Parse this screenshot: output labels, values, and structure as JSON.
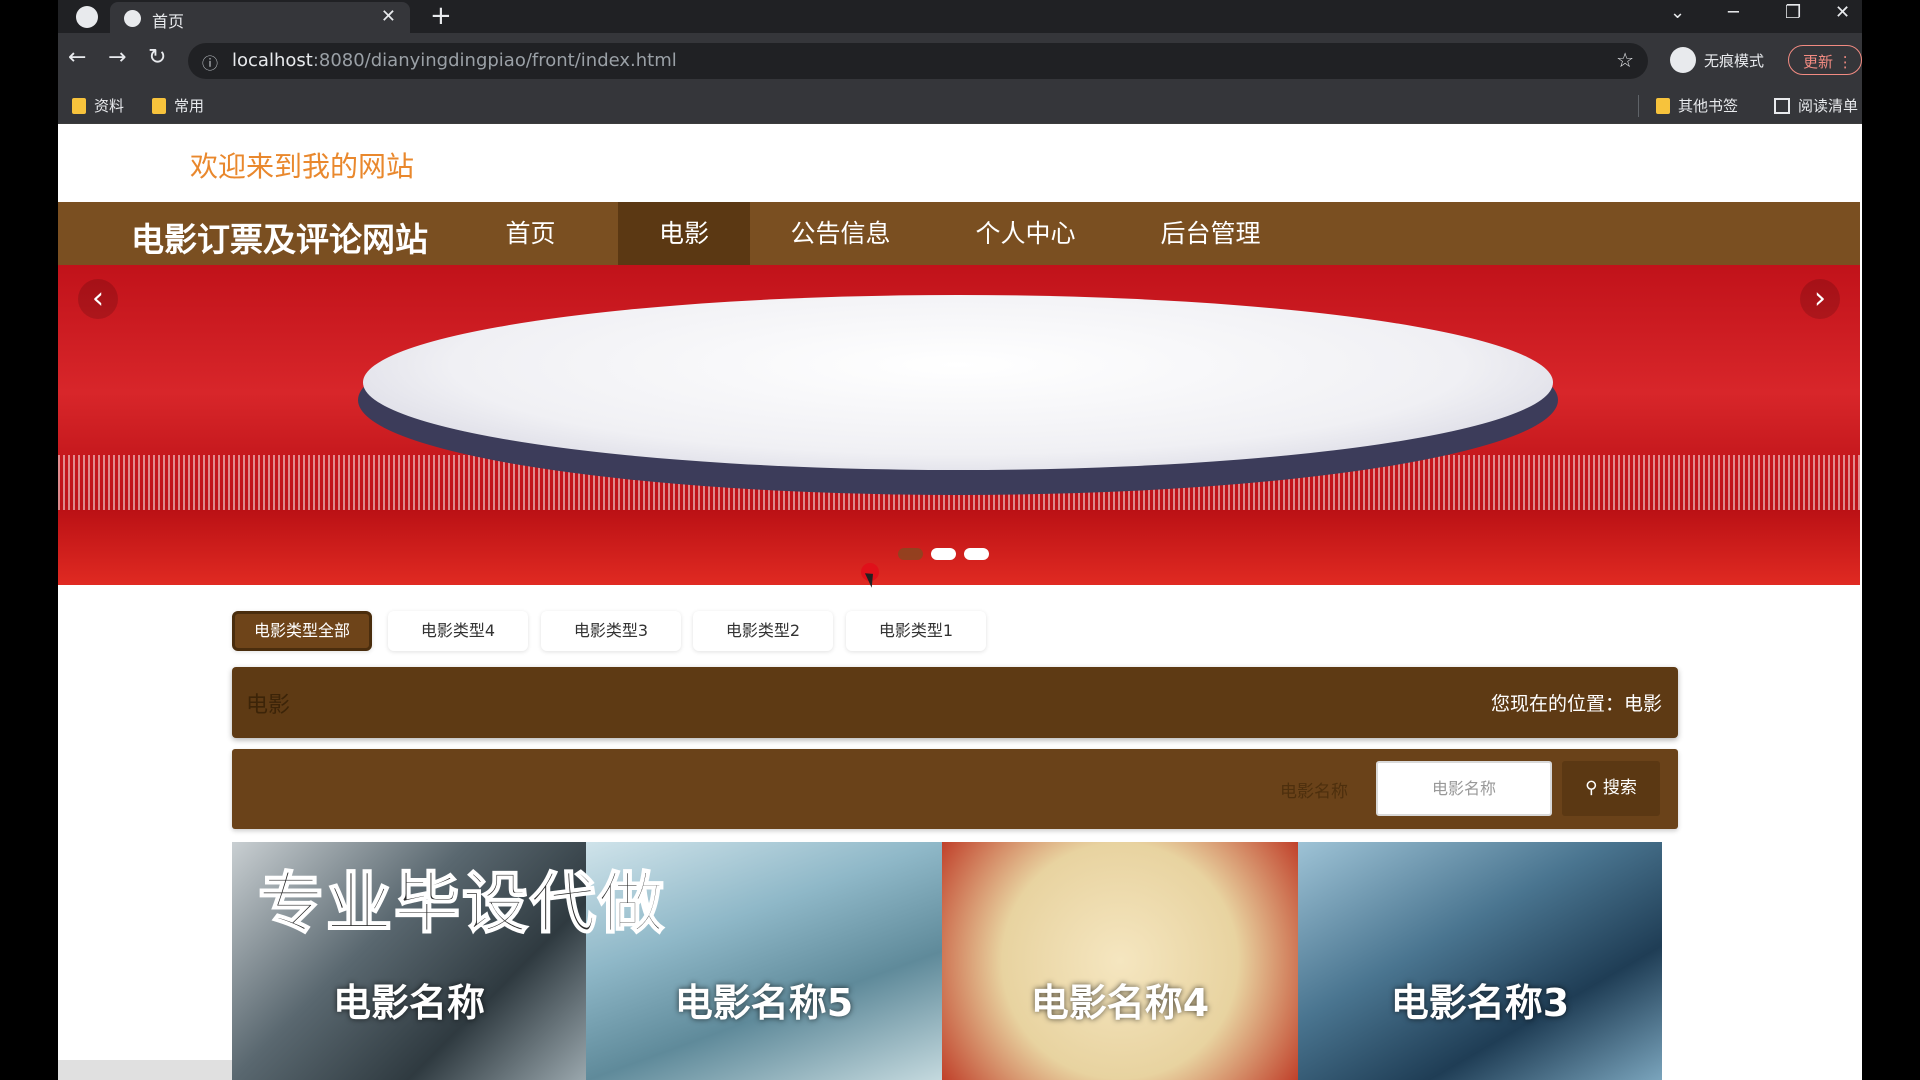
{
  "browser": {
    "tab_title": "首页",
    "tab_close": "✕",
    "new_tab": "+",
    "url_host": "localhost",
    "url_path": ":8080/dianyingdingpiao/front/index.html",
    "incognito_label": "无痕模式",
    "update_label": "更新",
    "bookmarks": [
      "资料",
      "常用"
    ],
    "other_bookmarks": "其他书签",
    "reading_list": "阅读清单"
  },
  "site": {
    "welcome": "欢迎来到我的网站",
    "brand": "电影订票及评论网站",
    "nav": [
      "首页",
      "电影",
      "公告信息",
      "个人中心",
      "后台管理"
    ],
    "active_nav": "电影"
  },
  "banner": {
    "prev": "‹",
    "next": "›",
    "slide_count": 3,
    "active_slide": 1
  },
  "categories": [
    "电影类型全部",
    "电影类型4",
    "电影类型3",
    "电影类型2",
    "电影类型1"
  ],
  "breadcrumb": {
    "left": "电影",
    "right": "您现在的位置：电影"
  },
  "search": {
    "label": "电影名称",
    "placeholder": "电影名称",
    "button": "搜索"
  },
  "movies": [
    {
      "name": "电影名称"
    },
    {
      "name": "电影名称5"
    },
    {
      "name": "电影名称4"
    },
    {
      "name": "电影名称3"
    }
  ],
  "watermark": "专业毕设代做",
  "colors": {
    "nav_brown": "#7a4f21",
    "nav_active": "#5b3813",
    "welcome_orange": "#e9882d",
    "banner_red": "#c1121a"
  }
}
